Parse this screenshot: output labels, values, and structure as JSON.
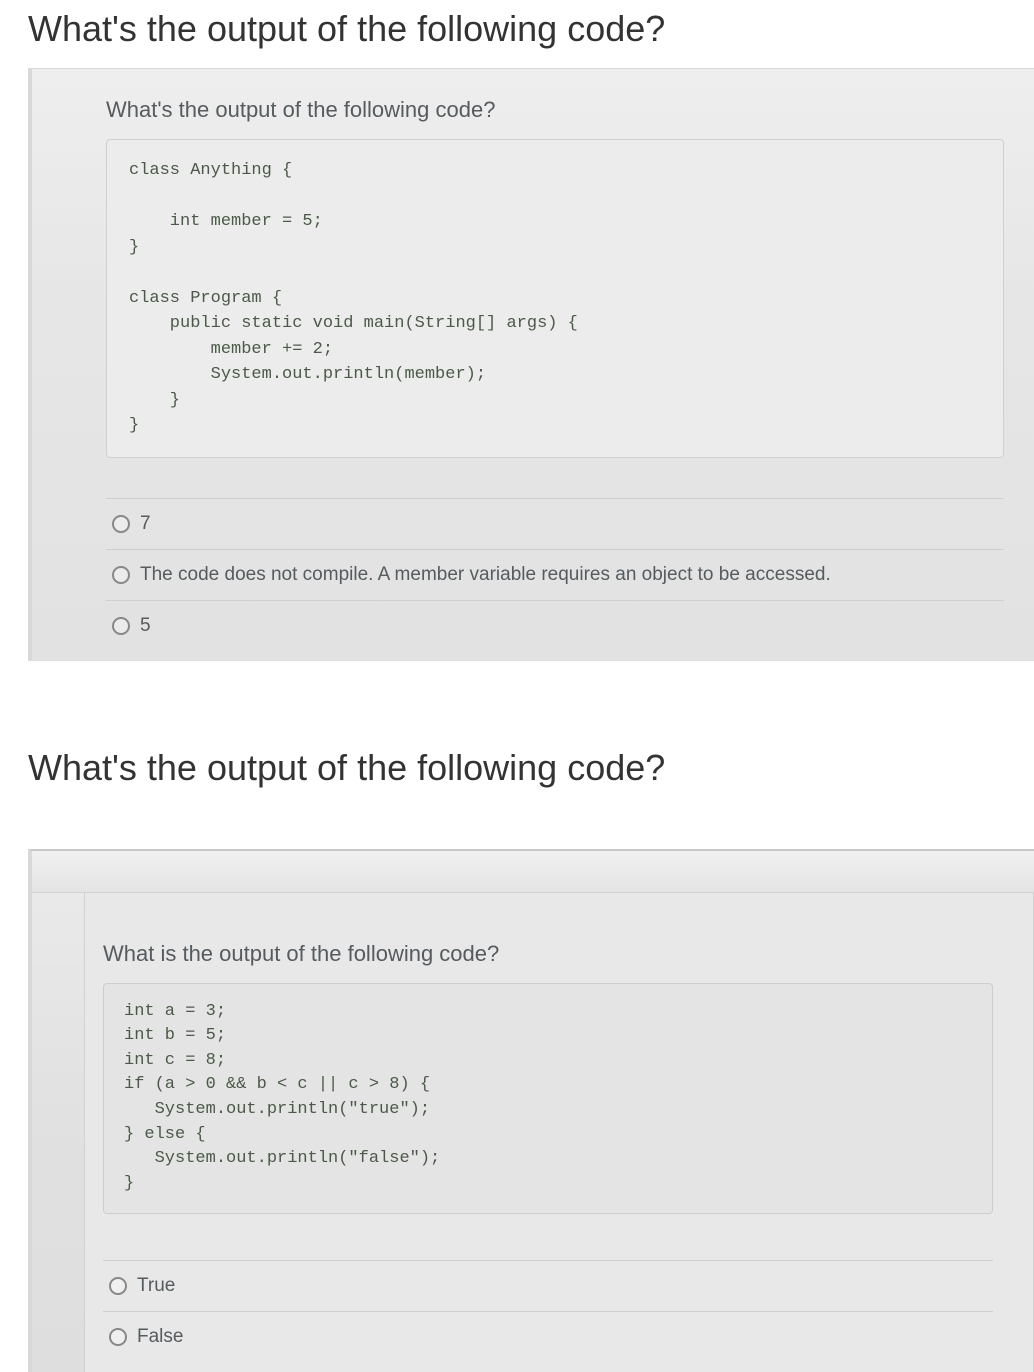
{
  "q1": {
    "outer_heading": "What's the output of the following code?",
    "prompt": "What's the output of the following code?",
    "code": "class Anything {\n\n    int member = 5;\n}\n\nclass Program {\n    public static void main(String[] args) {\n        member += 2;\n        System.out.println(member);\n    }\n}",
    "options": [
      "7",
      "The code does not compile. A member variable requires an object to be accessed.",
      "5"
    ]
  },
  "q2": {
    "outer_heading": "What's the output of the following code?",
    "prompt": "What is the output of the following code?",
    "code": "int a = 3;\nint b = 5;\nint c = 8;\nif (a > 0 && b < c || c > 8) {\n   System.out.println(\"true\");\n} else {\n   System.out.println(\"false\");\n}",
    "options": [
      "True",
      "False"
    ]
  }
}
